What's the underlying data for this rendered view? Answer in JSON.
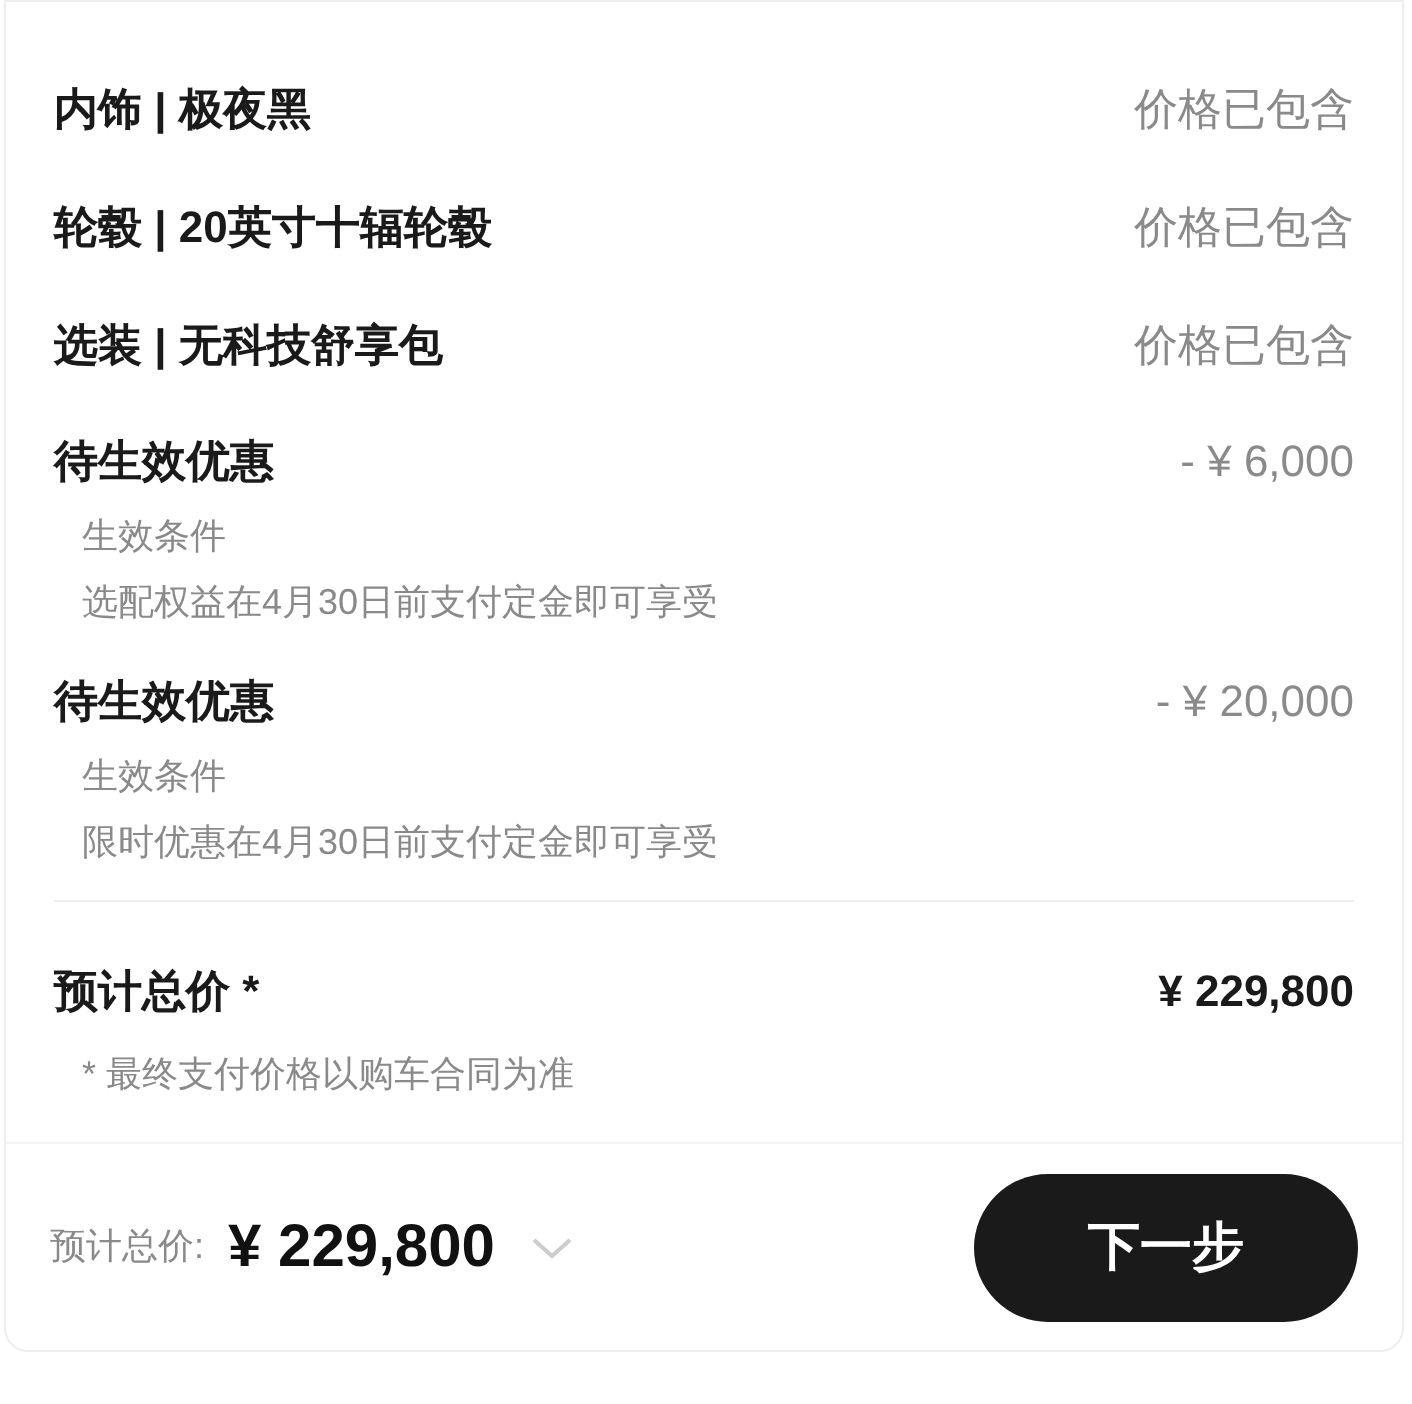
{
  "items": [
    {
      "label": "内饰 | 极夜黑",
      "value": "价格已包含"
    },
    {
      "label": "轮毂 | 20英寸十辐轮毂",
      "value": "价格已包含"
    },
    {
      "label": "选装 | 无科技舒享包",
      "value": "价格已包含"
    }
  ],
  "discounts": [
    {
      "label": "待生效优惠",
      "amount": "- ¥ 6,000",
      "condition_title": "生效条件",
      "condition": "选配权益在4月30日前支付定金即可享受"
    },
    {
      "label": "待生效优惠",
      "amount": "- ¥ 20,000",
      "condition_title": "生效条件",
      "condition": "限时优惠在4月30日前支付定金即可享受"
    }
  ],
  "total": {
    "label": "预计总价 *",
    "amount": "¥ 229,800",
    "note": "* 最终支付价格以购车合同为准"
  },
  "footer": {
    "label": "预计总价:",
    "amount": "¥ 229,800",
    "button": "下一步"
  }
}
